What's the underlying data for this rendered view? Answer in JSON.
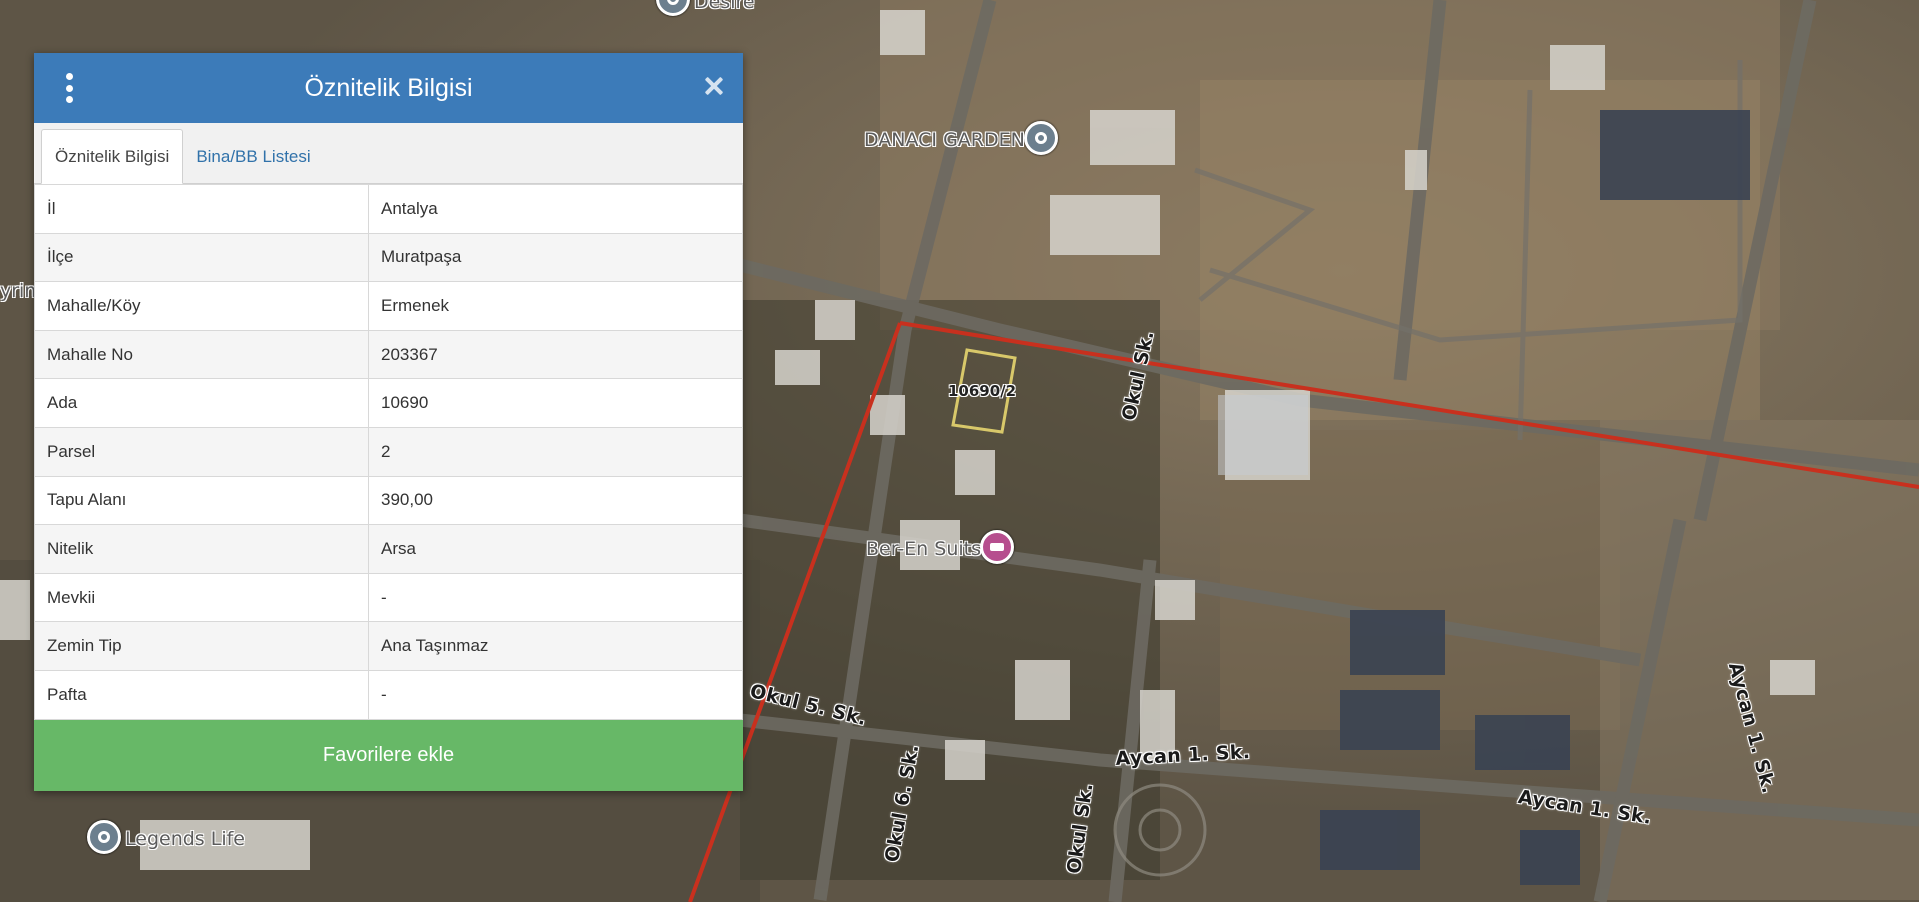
{
  "panel": {
    "title": "Öznitelik Bilgisi",
    "tabs": [
      {
        "label": "Öznitelik Bilgisi",
        "active": true
      },
      {
        "label": "Bina/BB Listesi",
        "active": false
      }
    ],
    "rows": [
      {
        "key": "İl",
        "value": "Antalya"
      },
      {
        "key": "İlçe",
        "value": "Muratpaşa"
      },
      {
        "key": "Mahalle/Köy",
        "value": "Ermenek"
      },
      {
        "key": "Mahalle No",
        "value": "203367"
      },
      {
        "key": "Ada",
        "value": "10690"
      },
      {
        "key": "Parsel",
        "value": "2"
      },
      {
        "key": "Tapu Alanı",
        "value": "390,00"
      },
      {
        "key": "Nitelik",
        "value": "Arsa"
      },
      {
        "key": "Mevkii",
        "value": "-"
      },
      {
        "key": "Zemin Tip",
        "value": "Ana Taşınmaz"
      },
      {
        "key": "Pafta",
        "value": "-"
      }
    ],
    "favorite_button": "Favorilere ekle",
    "header_color": "#3c7bb9",
    "button_color": "#67b867"
  },
  "map": {
    "parcel_label": "10690/2",
    "pois": {
      "danaci": "DANACI GARDEN",
      "beren": "Ber-En Suits",
      "legends": "Legends Life",
      "desire": "Desire",
      "left_cut": "yrim"
    },
    "streets": {
      "okul_top": "Okul Sk.",
      "okul_bottom": "Okul Sk.",
      "okul5": "Okul 5. Sk.",
      "okul6": "Okul 6. Sk.",
      "aycan1_a": "Aycan 1. Sk.",
      "aycan1_b": "Aycan 1. Sk.",
      "aycan1_right": "Aycan 1. Sk."
    },
    "boundary_color": "#c8301e"
  }
}
